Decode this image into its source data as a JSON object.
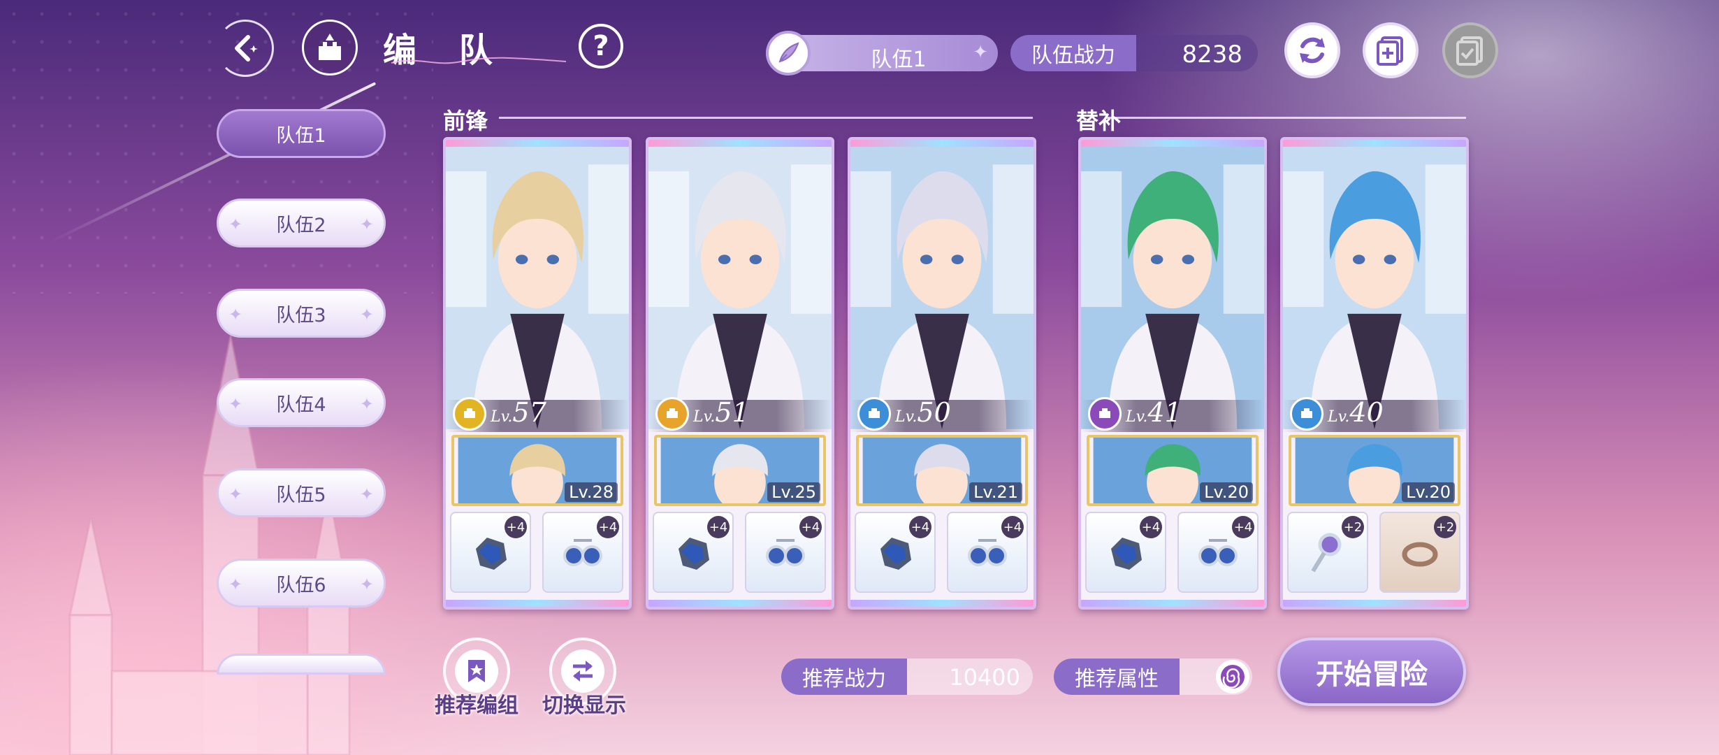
{
  "header": {
    "title": "编 队",
    "team_selector": "队伍1",
    "power_label": "队伍战力",
    "power_value": "8238"
  },
  "teams": [
    {
      "label": "队伍1",
      "active": true
    },
    {
      "label": "队伍2",
      "active": false
    },
    {
      "label": "队伍3",
      "active": false
    },
    {
      "label": "队伍4",
      "active": false
    },
    {
      "label": "队伍5",
      "active": false
    },
    {
      "label": "队伍6",
      "active": false
    }
  ],
  "sections": {
    "front": "前锋",
    "reserve": "替补"
  },
  "cards": [
    {
      "level": "57",
      "element_color": "#e2b422",
      "support_level": "Lv.28",
      "equip1_plus": "+4",
      "equip2_plus": "+4",
      "hair": "#e8cfa0",
      "bg": "#cfe0f2"
    },
    {
      "level": "51",
      "element_color": "#e8a32a",
      "support_level": "Lv.25",
      "equip1_plus": "+4",
      "equip2_plus": "+4",
      "hair": "#e6e6ee",
      "bg": "#d6e4f4"
    },
    {
      "level": "50",
      "element_color": "#3c8ed8",
      "support_level": "Lv.21",
      "equip1_plus": "+4",
      "equip2_plus": "+4",
      "hair": "#dcdcec",
      "bg": "#bcd6f0"
    },
    {
      "level": "41",
      "element_color": "#8a4ab8",
      "support_level": "Lv.20",
      "equip1_plus": "+4",
      "equip2_plus": "+4",
      "hair": "#3fb07a",
      "bg": "#a9cbeb"
    },
    {
      "level": "40",
      "element_color": "#3c8ed8",
      "support_level": "Lv.20",
      "equip1_plus": "+2",
      "equip2_plus": "+2",
      "hair": "#4a9ee0",
      "bg": "#c6dcf2"
    }
  ],
  "lv_prefix": "Lv.",
  "bottom": {
    "recommend_team_label": "推荐编组",
    "switch_display_label": "切换显示",
    "recommend_power_label": "推荐战力",
    "recommend_power_value": "10400",
    "recommend_attr_label": "推荐属性",
    "start_label": "开始冒险"
  }
}
